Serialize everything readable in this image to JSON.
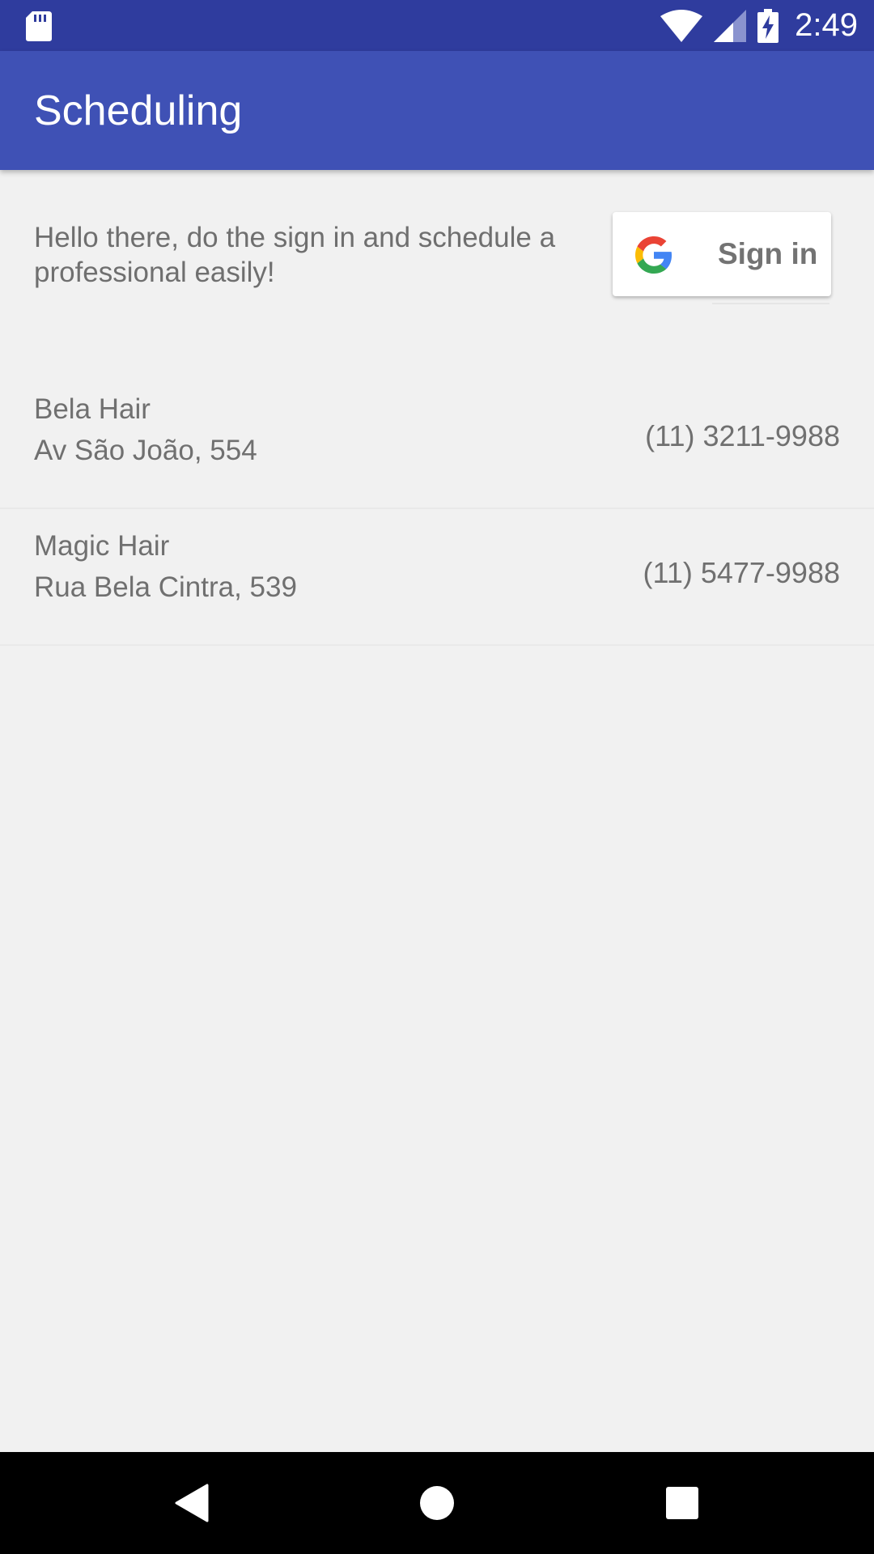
{
  "status_bar": {
    "time": "2:49",
    "icons": [
      "sd-card-icon",
      "wifi-icon",
      "cell-signal-icon",
      "battery-charging-icon"
    ]
  },
  "app_bar": {
    "title": "Scheduling"
  },
  "intro": {
    "text": "Hello there, do the sign in and schedule a professional easily!"
  },
  "signin_button": {
    "label": "Sign in",
    "icon": "google-icon"
  },
  "salons": [
    {
      "name": "Bela Hair",
      "address": "Av São João, 554",
      "phone": "(11) 3211-9988"
    },
    {
      "name": "Magic Hair",
      "address": "Rua Bela Cintra, 539",
      "phone": "(11) 5477-9988"
    }
  ],
  "nav_bar": {
    "buttons": [
      "back-icon",
      "home-icon",
      "recents-icon"
    ]
  },
  "colors": {
    "status_bar": "#2f3c9e",
    "app_bar": "#3f51b5",
    "background": "#f1f1f1",
    "text_gray": "#707070"
  }
}
